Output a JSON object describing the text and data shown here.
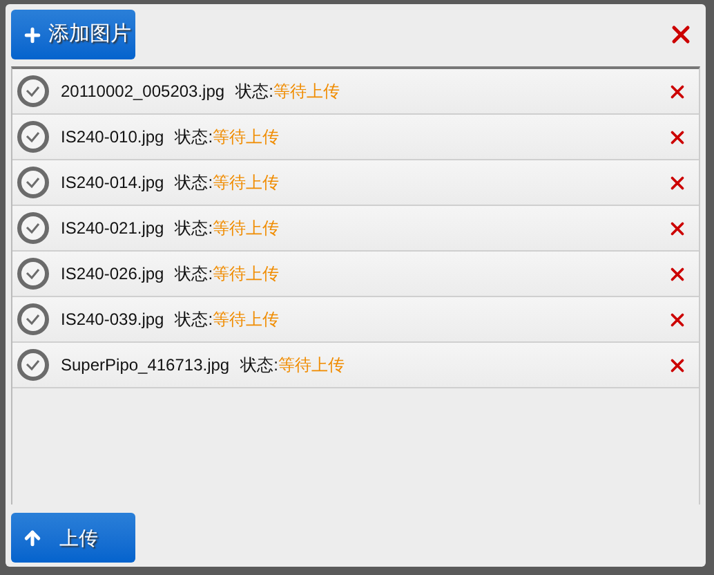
{
  "toolbar": {
    "add_button": "添加图片"
  },
  "files": [
    {
      "name": "20110002_005203.jpg",
      "status_label": "状态:",
      "status": "等待上传"
    },
    {
      "name": "IS240-010.jpg",
      "status_label": "状态:",
      "status": "等待上传"
    },
    {
      "name": "IS240-014.jpg",
      "status_label": "状态:",
      "status": "等待上传"
    },
    {
      "name": "IS240-021.jpg",
      "status_label": "状态:",
      "status": "等待上传"
    },
    {
      "name": "IS240-026.jpg",
      "status_label": "状态:",
      "status": "等待上传"
    },
    {
      "name": "IS240-039.jpg",
      "status_label": "状态:",
      "status": "等待上传"
    },
    {
      "name": "SuperPipo_416713.jpg",
      "status_label": "状态:",
      "status": "等待上传"
    }
  ],
  "footer": {
    "upload_button": "上传"
  }
}
